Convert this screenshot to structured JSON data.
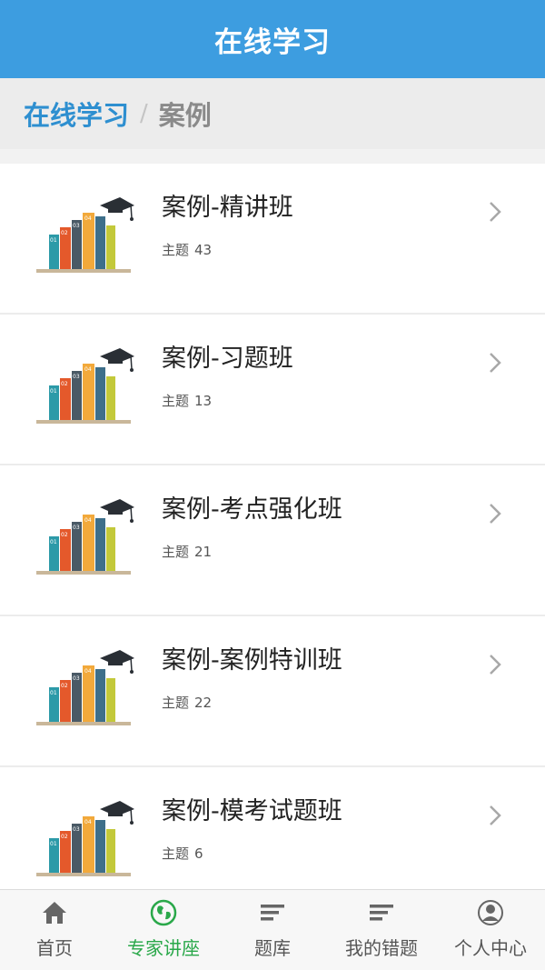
{
  "header": {
    "title": "在线学习"
  },
  "breadcrumb": {
    "parent": "在线学习",
    "separator": "/",
    "current": "案例"
  },
  "list": {
    "items": [
      {
        "name": "案例-精讲班",
        "meta_label": "主题",
        "count": "43"
      },
      {
        "name": "案例-习题班",
        "meta_label": "主题",
        "count": "13"
      },
      {
        "name": "案例-考点强化班",
        "meta_label": "主题",
        "count": "21"
      },
      {
        "name": "案例-案例特训班",
        "meta_label": "主题",
        "count": "22"
      },
      {
        "name": "案例-模考试题班",
        "meta_label": "主题",
        "count": "6"
      }
    ]
  },
  "tabbar": {
    "tabs": [
      {
        "label": "首页",
        "icon": "home-icon"
      },
      {
        "label": "专家讲座",
        "icon": "globe-icon",
        "active": true
      },
      {
        "label": "题库",
        "icon": "list-icon"
      },
      {
        "label": "我的错题",
        "icon": "list-icon"
      },
      {
        "label": "个人中心",
        "icon": "user-icon"
      }
    ]
  },
  "colors": {
    "header_bg": "#3d9de0",
    "breadcrumb_link": "#2e8fd0",
    "active_tab": "#2aa84a"
  },
  "thumbnail": {
    "icon": "books-graduation-cap-icon",
    "book_numbers": [
      "01",
      "02",
      "03",
      "04"
    ]
  }
}
